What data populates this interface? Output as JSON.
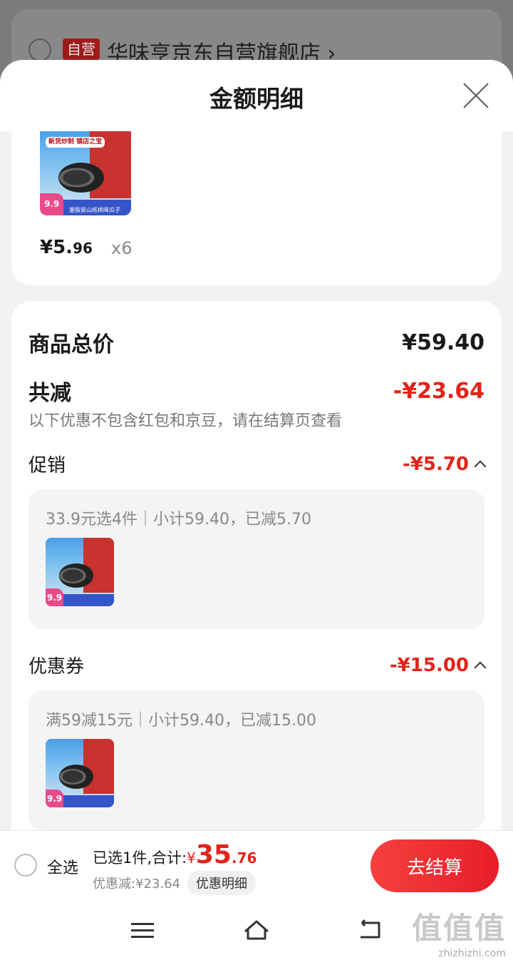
{
  "background_store": {
    "tag": "自营",
    "name": "华味亨京东自营旗舰店",
    "chevron": "›"
  },
  "sheet": {
    "title": "金额明细"
  },
  "product": {
    "image_badge": "新货炒制 镇店之宝",
    "image_price": "9.9",
    "image_label": "量贩装山核桃味瓜子",
    "unit_price_main": "¥5.",
    "unit_price_decimal": "96",
    "quantity": "x6"
  },
  "summary": {
    "total_label": "商品总价",
    "total_value": "¥59.40",
    "reduce_label": "共减",
    "reduce_value": "-¥23.64",
    "note": "以下优惠不包含红包和京豆，请在结算页查看"
  },
  "promotions": {
    "label": "促销",
    "value": "-¥5.70",
    "desc": "33.9元选4件｜小计59.40，已减5.70"
  },
  "coupons": {
    "label": "优惠券",
    "value": "-¥15.00",
    "desc": "满59减15元｜小计59.40，已减15.00"
  },
  "bottom_bar": {
    "select_all": "全选",
    "selected_text": "已选1件,合计:",
    "currency": "¥",
    "total_int": "35",
    "total_dec": ".76",
    "discount_text": "优惠减:¥23.64",
    "detail_chip": "优惠明细",
    "checkout": "去结算"
  },
  "watermark": {
    "big": "值值值",
    "site": "zhizhizhi.com"
  },
  "colors": {
    "accent_red": "#e2231a",
    "checkout_gradient_start": "#f5413c",
    "checkout_gradient_end": "#e71d2a"
  },
  "icons": {
    "close": "close-icon",
    "chevron_up": "chevron-up-icon",
    "nav_menu": "menu-icon",
    "nav_home": "home-icon",
    "nav_back": "back-icon"
  }
}
